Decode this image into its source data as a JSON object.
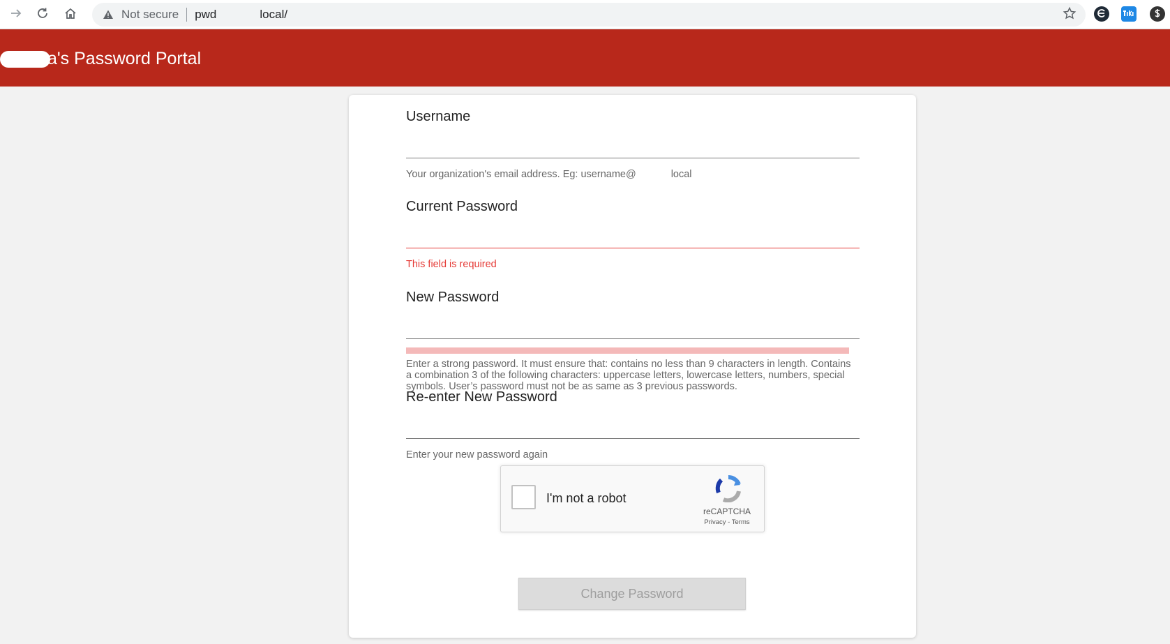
{
  "browser": {
    "security_label": "Not secure",
    "url_prefix": "pwd",
    "url_suffix": "local/"
  },
  "header": {
    "title": "a's Password Portal",
    "background": "#b8281b"
  },
  "form": {
    "username": {
      "label": "Username",
      "value": "",
      "hint": "Your organization's email address. Eg: username@",
      "hint_suffix": "local"
    },
    "current_password": {
      "label": "Current Password",
      "value": "",
      "error": "This field is required"
    },
    "new_password": {
      "label": "New Password",
      "value": "",
      "hint": "Enter a strong password. It must ensure that: contains no less than 9 characters in length. Contains a combination 3 of the following characters: uppercase letters, lowercase letters, numbers, special symbols. User’s password must not be as same as 3 previous passwords."
    },
    "confirm_password": {
      "label": "Re-enter New Password",
      "value": "",
      "hint": "Enter your new password again"
    },
    "recaptcha": {
      "label": "I'm not a robot",
      "brand": "reCAPTCHA",
      "links": "Privacy - Terms",
      "checked": false
    },
    "submit_label": "Change Password"
  },
  "colors": {
    "error": "#e53935",
    "strength_bar": "#f4b9b9",
    "accent_ext_blue": "#1e88e5"
  },
  "icons": {
    "back": "arrow-right-icon",
    "reload": "reload-icon",
    "home": "home-icon",
    "warning": "warning-icon",
    "bookmark": "star-icon"
  }
}
